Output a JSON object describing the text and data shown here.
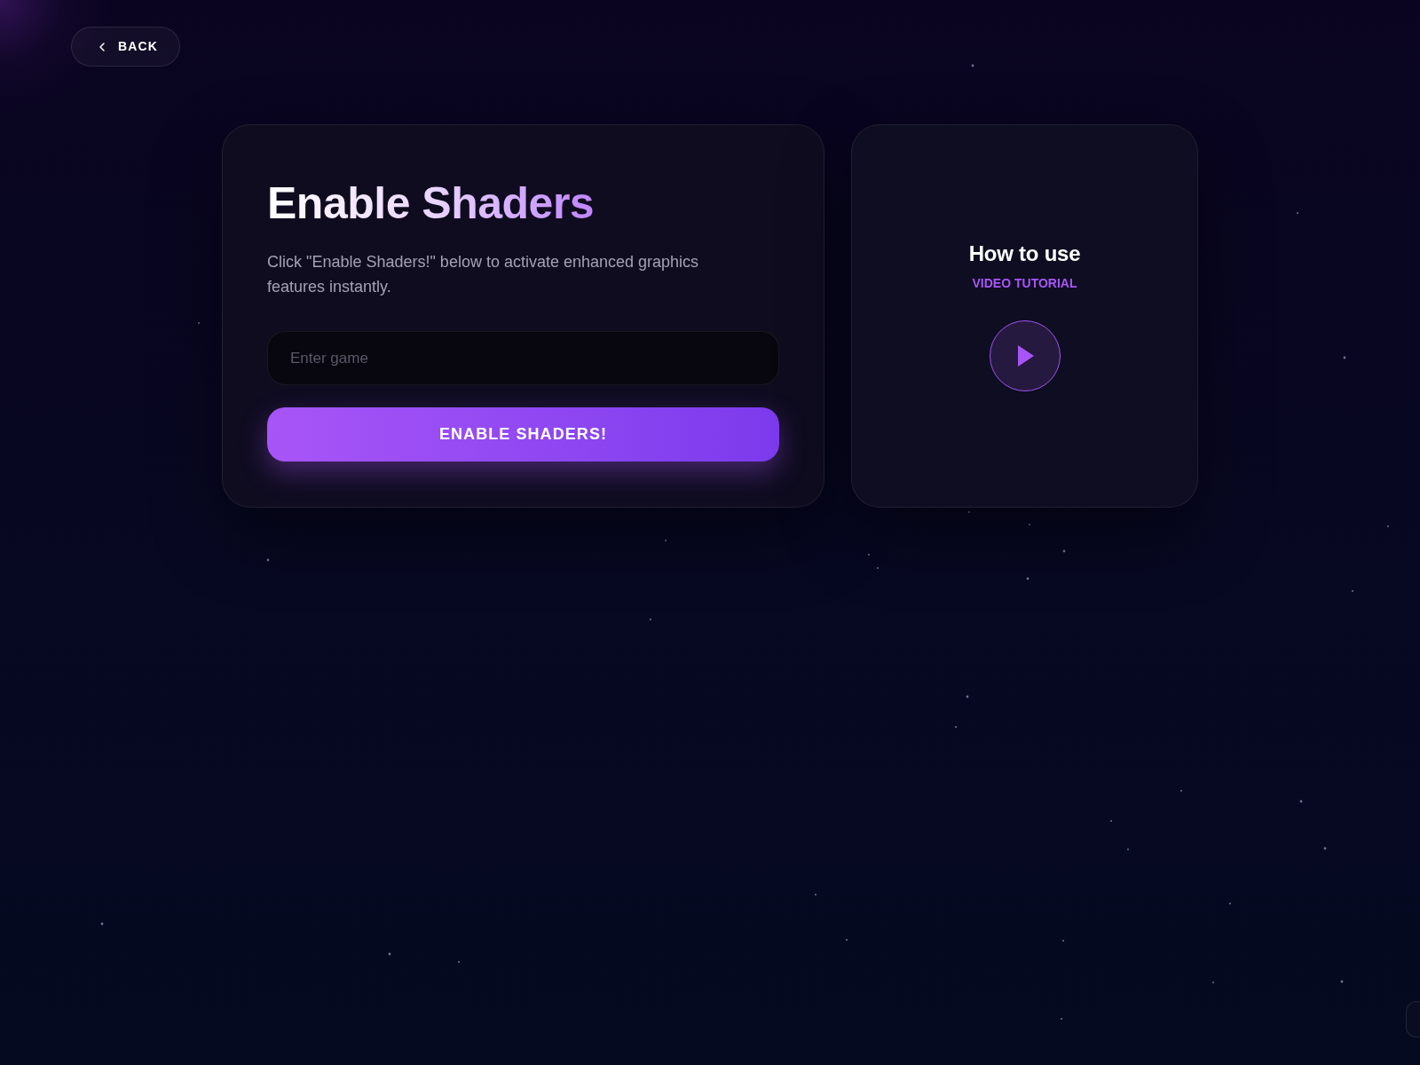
{
  "back_button": {
    "label": "BACK"
  },
  "main_card": {
    "title": "Enable Shaders",
    "description": "Click \"Enable Shaders!\" below to activate enhanced graphics features instantly.",
    "input": {
      "placeholder": "Enter game"
    },
    "button": {
      "label": "ENABLE SHADERS!"
    }
  },
  "tutorial_card": {
    "title": "How to use",
    "subtitle": "VIDEO TUTORIAL"
  }
}
